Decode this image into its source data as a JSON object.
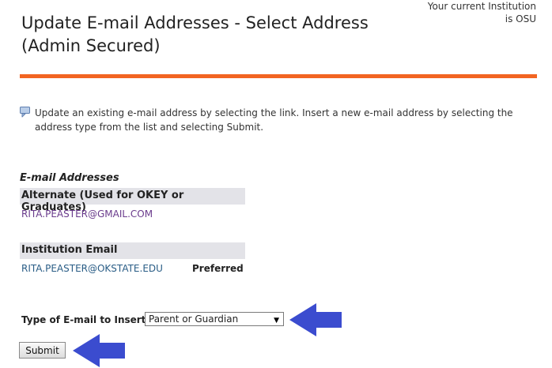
{
  "institution": {
    "line1": "Your current Institution",
    "line2": "is OSU"
  },
  "page": {
    "title_line1": "Update E-mail Addresses - Select Address",
    "title_line2": "(Admin Secured)"
  },
  "info": {
    "icon": "info-icon",
    "text": "Update an existing e-mail address by selecting the link. Insert a new e-mail address by selecting the address type from the list and selecting Submit."
  },
  "emails": {
    "section_label": "E-mail Addresses",
    "alternate": {
      "header": "Alternate (Used for OKEY or Graduates)",
      "address": "RITA.PEASTER@GMAIL.COM"
    },
    "institution": {
      "header": "Institution Email",
      "address": "RITA.PEASTER@OKSTATE.EDU",
      "flag": "Preferred"
    }
  },
  "insert": {
    "label": "Type of E-mail to Insert:",
    "selected": "Parent or Guardian",
    "submit": "Submit"
  },
  "colors": {
    "accent_rule": "#f26522",
    "arrow": "#3b4ccf",
    "band": "#e3e3e8"
  }
}
